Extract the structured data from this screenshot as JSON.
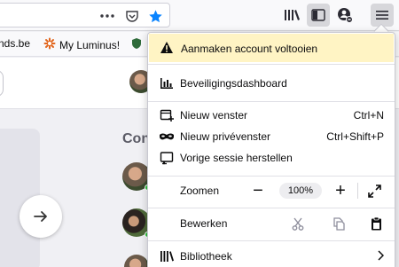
{
  "bookmarks": [
    {
      "label": "nds.be"
    },
    {
      "label": "My Luminus!"
    }
  ],
  "page": {
    "section_title": "Con"
  },
  "menu": {
    "notice": "Aanmaken account voltooien",
    "security": "Beveiligingsdashboard",
    "new_window": {
      "label": "Nieuw venster",
      "shortcut": "Ctrl+N"
    },
    "private_window": {
      "label": "Nieuw privévenster",
      "shortcut": "Ctrl+Shift+P"
    },
    "restore_session": "Vorige sessie herstellen",
    "zoom": {
      "label": "Zoomen",
      "value": "100%",
      "minus": "−",
      "plus": "+"
    },
    "edit": {
      "label": "Bewerken"
    },
    "library": "Bibliotheek"
  }
}
